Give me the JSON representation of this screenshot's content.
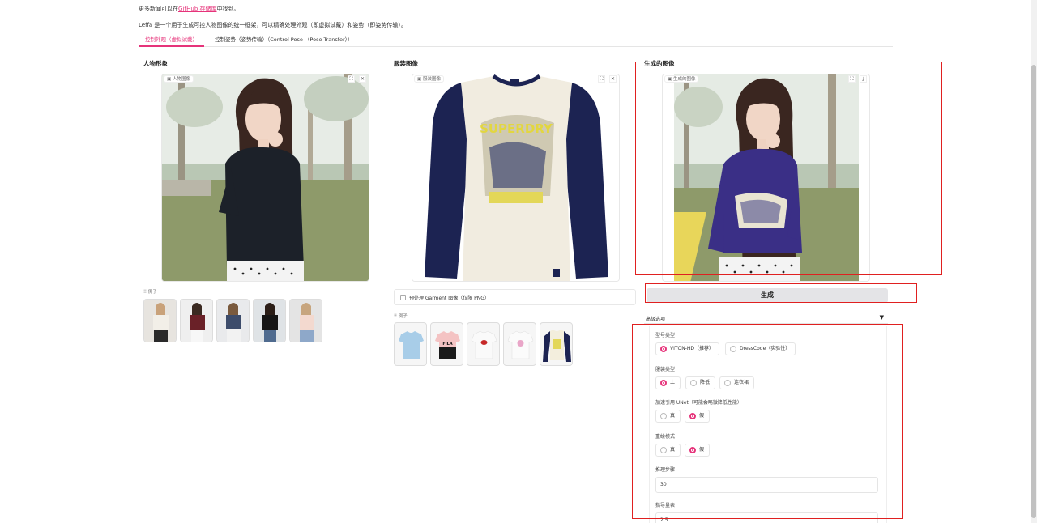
{
  "intro": {
    "line1_prefix": "更多新闻可以在",
    "line1_link": "GitHub 存储库",
    "line1_suffix": "中找到。",
    "line2": "Leffa 是一个用于生成可控人物图像的统一框架，可以精确处理外观（即虚拟试戴）和姿势（即姿势传输）。"
  },
  "tabs": [
    {
      "label": "控制外观（虚拟试戴）",
      "active": true
    },
    {
      "label": "控制姿势（姿势传输）（Control Pose （Pose Transfer））",
      "active": false
    }
  ],
  "person": {
    "title": "人物形象",
    "image_label": "人物图像",
    "examples_label": "例子"
  },
  "garment": {
    "title": "服装图像",
    "image_label": "服装图像",
    "shirt_text": "SUPERDRY",
    "preprocess_label": "预处理 Garment 图像（仅限 PNG）",
    "examples_label": "例子",
    "example_fila_text": "FILA"
  },
  "output": {
    "title": "生成的图像",
    "image_label": "生成的图像",
    "generate_button": "生成",
    "advanced_title": "高级选项",
    "model_type": {
      "label": "型号类型",
      "options": [
        "VITON-HD（推荐）",
        "DressCode（实验性）"
      ],
      "selected": 0
    },
    "garment_type": {
      "label": "服装类型",
      "options": [
        "上",
        "降低",
        "连衣裙"
      ],
      "selected": 0
    },
    "ref_unet": {
      "label": "加速引用 UNet（可能会略微降低性能）",
      "options": [
        "真",
        "假"
      ],
      "selected": 1
    },
    "repaint": {
      "label": "重绘模式",
      "options": [
        "真",
        "假"
      ],
      "selected": 1
    },
    "steps": {
      "label": "推理步骤",
      "value": "30"
    },
    "guidance": {
      "label": "指导量表",
      "value": "2.5"
    }
  },
  "colors": {
    "accent": "#e6337a",
    "highlight": "#e02020"
  },
  "icons": {
    "expand": "fullscreen-icon",
    "close": "close-icon",
    "download": "download-icon",
    "image": "image-icon",
    "grid": "grid-icon"
  }
}
